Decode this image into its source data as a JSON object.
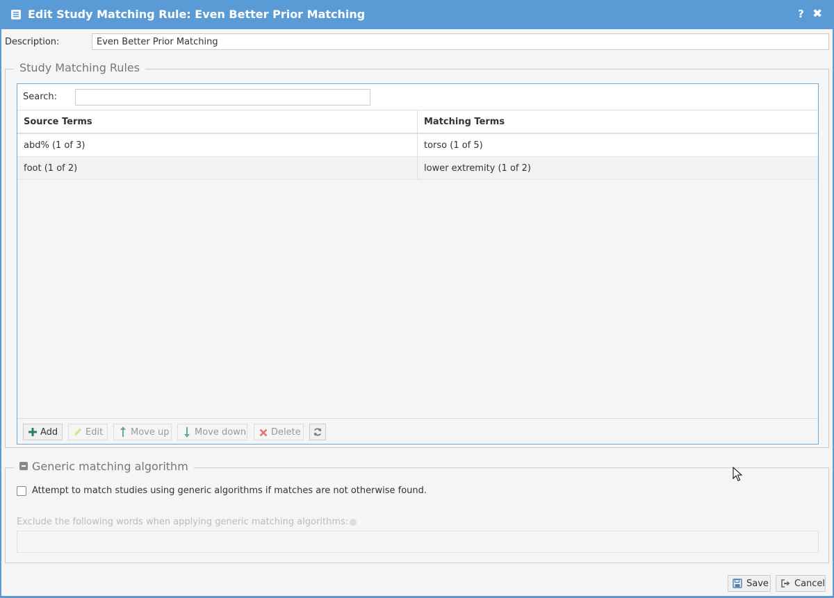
{
  "dialog": {
    "title": "Edit Study Matching Rule: Even Better Prior Matching",
    "help_label": "?",
    "close_label": "✖"
  },
  "description": {
    "label": "Description:",
    "value": "Even Better Prior Matching"
  },
  "rules": {
    "legend": "Study Matching Rules",
    "search_label": "Search:",
    "search_value": "",
    "columns": [
      "Source Terms",
      "Matching Terms"
    ],
    "rows": [
      {
        "source": "abd% (1 of 3)",
        "matching": "torso (1 of 5)"
      },
      {
        "source": "foot (1 of 2)",
        "matching": "lower extremity (1 of 2)"
      }
    ],
    "toolbar": {
      "add": "Add",
      "edit": "Edit",
      "move_up": "Move up",
      "move_down": "Move down",
      "delete": "Delete"
    }
  },
  "generic": {
    "legend": "Generic matching algorithm",
    "checkbox_label": "Attempt to match studies using generic algorithms if matches are not otherwise found.",
    "checkbox_checked": false,
    "exclude_label": "Exclude the following words when applying generic matching algorithms:",
    "exclude_value": ""
  },
  "footer": {
    "save": "Save",
    "cancel": "Cancel"
  },
  "colors": {
    "titlebar": "#5b9bd5",
    "add_icon": "#2e7d5b",
    "delete_icon": "#e57373",
    "move_icon": "#6aa88e"
  }
}
